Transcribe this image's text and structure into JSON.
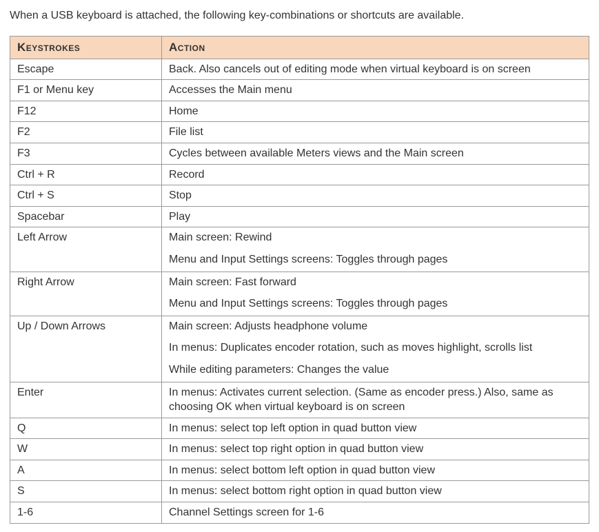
{
  "intro": "When a USB keyboard is attached, the following key-combinations or shortcuts are available.",
  "headers": {
    "keystrokes": "Keystrokes",
    "action": "Action"
  },
  "rows": [
    {
      "key": "Escape",
      "actions": [
        "Back. Also cancels out of editing mode when virtual keyboard is on screen"
      ]
    },
    {
      "key": "F1 or Menu key",
      "actions": [
        "Accesses the Main menu"
      ]
    },
    {
      "key": "F12",
      "actions": [
        "Home"
      ]
    },
    {
      "key": "F2",
      "actions": [
        "File list"
      ]
    },
    {
      "key": "F3",
      "actions": [
        "Cycles between available Meters views and the Main screen"
      ]
    },
    {
      "key": "Ctrl + R",
      "actions": [
        "Record"
      ]
    },
    {
      "key": "Ctrl + S",
      "actions": [
        "Stop"
      ]
    },
    {
      "key": "Spacebar",
      "actions": [
        "Play"
      ]
    },
    {
      "key": "Left Arrow",
      "actions": [
        "Main screen: Rewind",
        "Menu and Input Settings screens: Toggles through pages"
      ]
    },
    {
      "key": "Right Arrow",
      "actions": [
        "Main screen: Fast forward",
        "Menu and Input Settings screens: Toggles through pages"
      ]
    },
    {
      "key": "Up / Down Arrows",
      "actions": [
        "Main screen: Adjusts headphone volume",
        "In menus: Duplicates encoder rotation, such as moves highlight, scrolls list",
        "While editing parameters: Changes the value"
      ]
    },
    {
      "key": "Enter",
      "actions": [
        "In menus: Activates current selection. (Same as encoder press.) Also, same as choosing OK when virtual keyboard is on screen"
      ]
    },
    {
      "key": "Q",
      "actions": [
        "In menus: select top left option in quad button view"
      ]
    },
    {
      "key": "W",
      "actions": [
        "In menus: select top right option in quad button view"
      ]
    },
    {
      "key": "A",
      "actions": [
        "In menus: select bottom left option in quad button view"
      ]
    },
    {
      "key": "S",
      "actions": [
        "In menus: select bottom right option in quad button view"
      ]
    },
    {
      "key": "1-6",
      "actions": [
        "Channel Settings screen for 1-6"
      ]
    }
  ]
}
